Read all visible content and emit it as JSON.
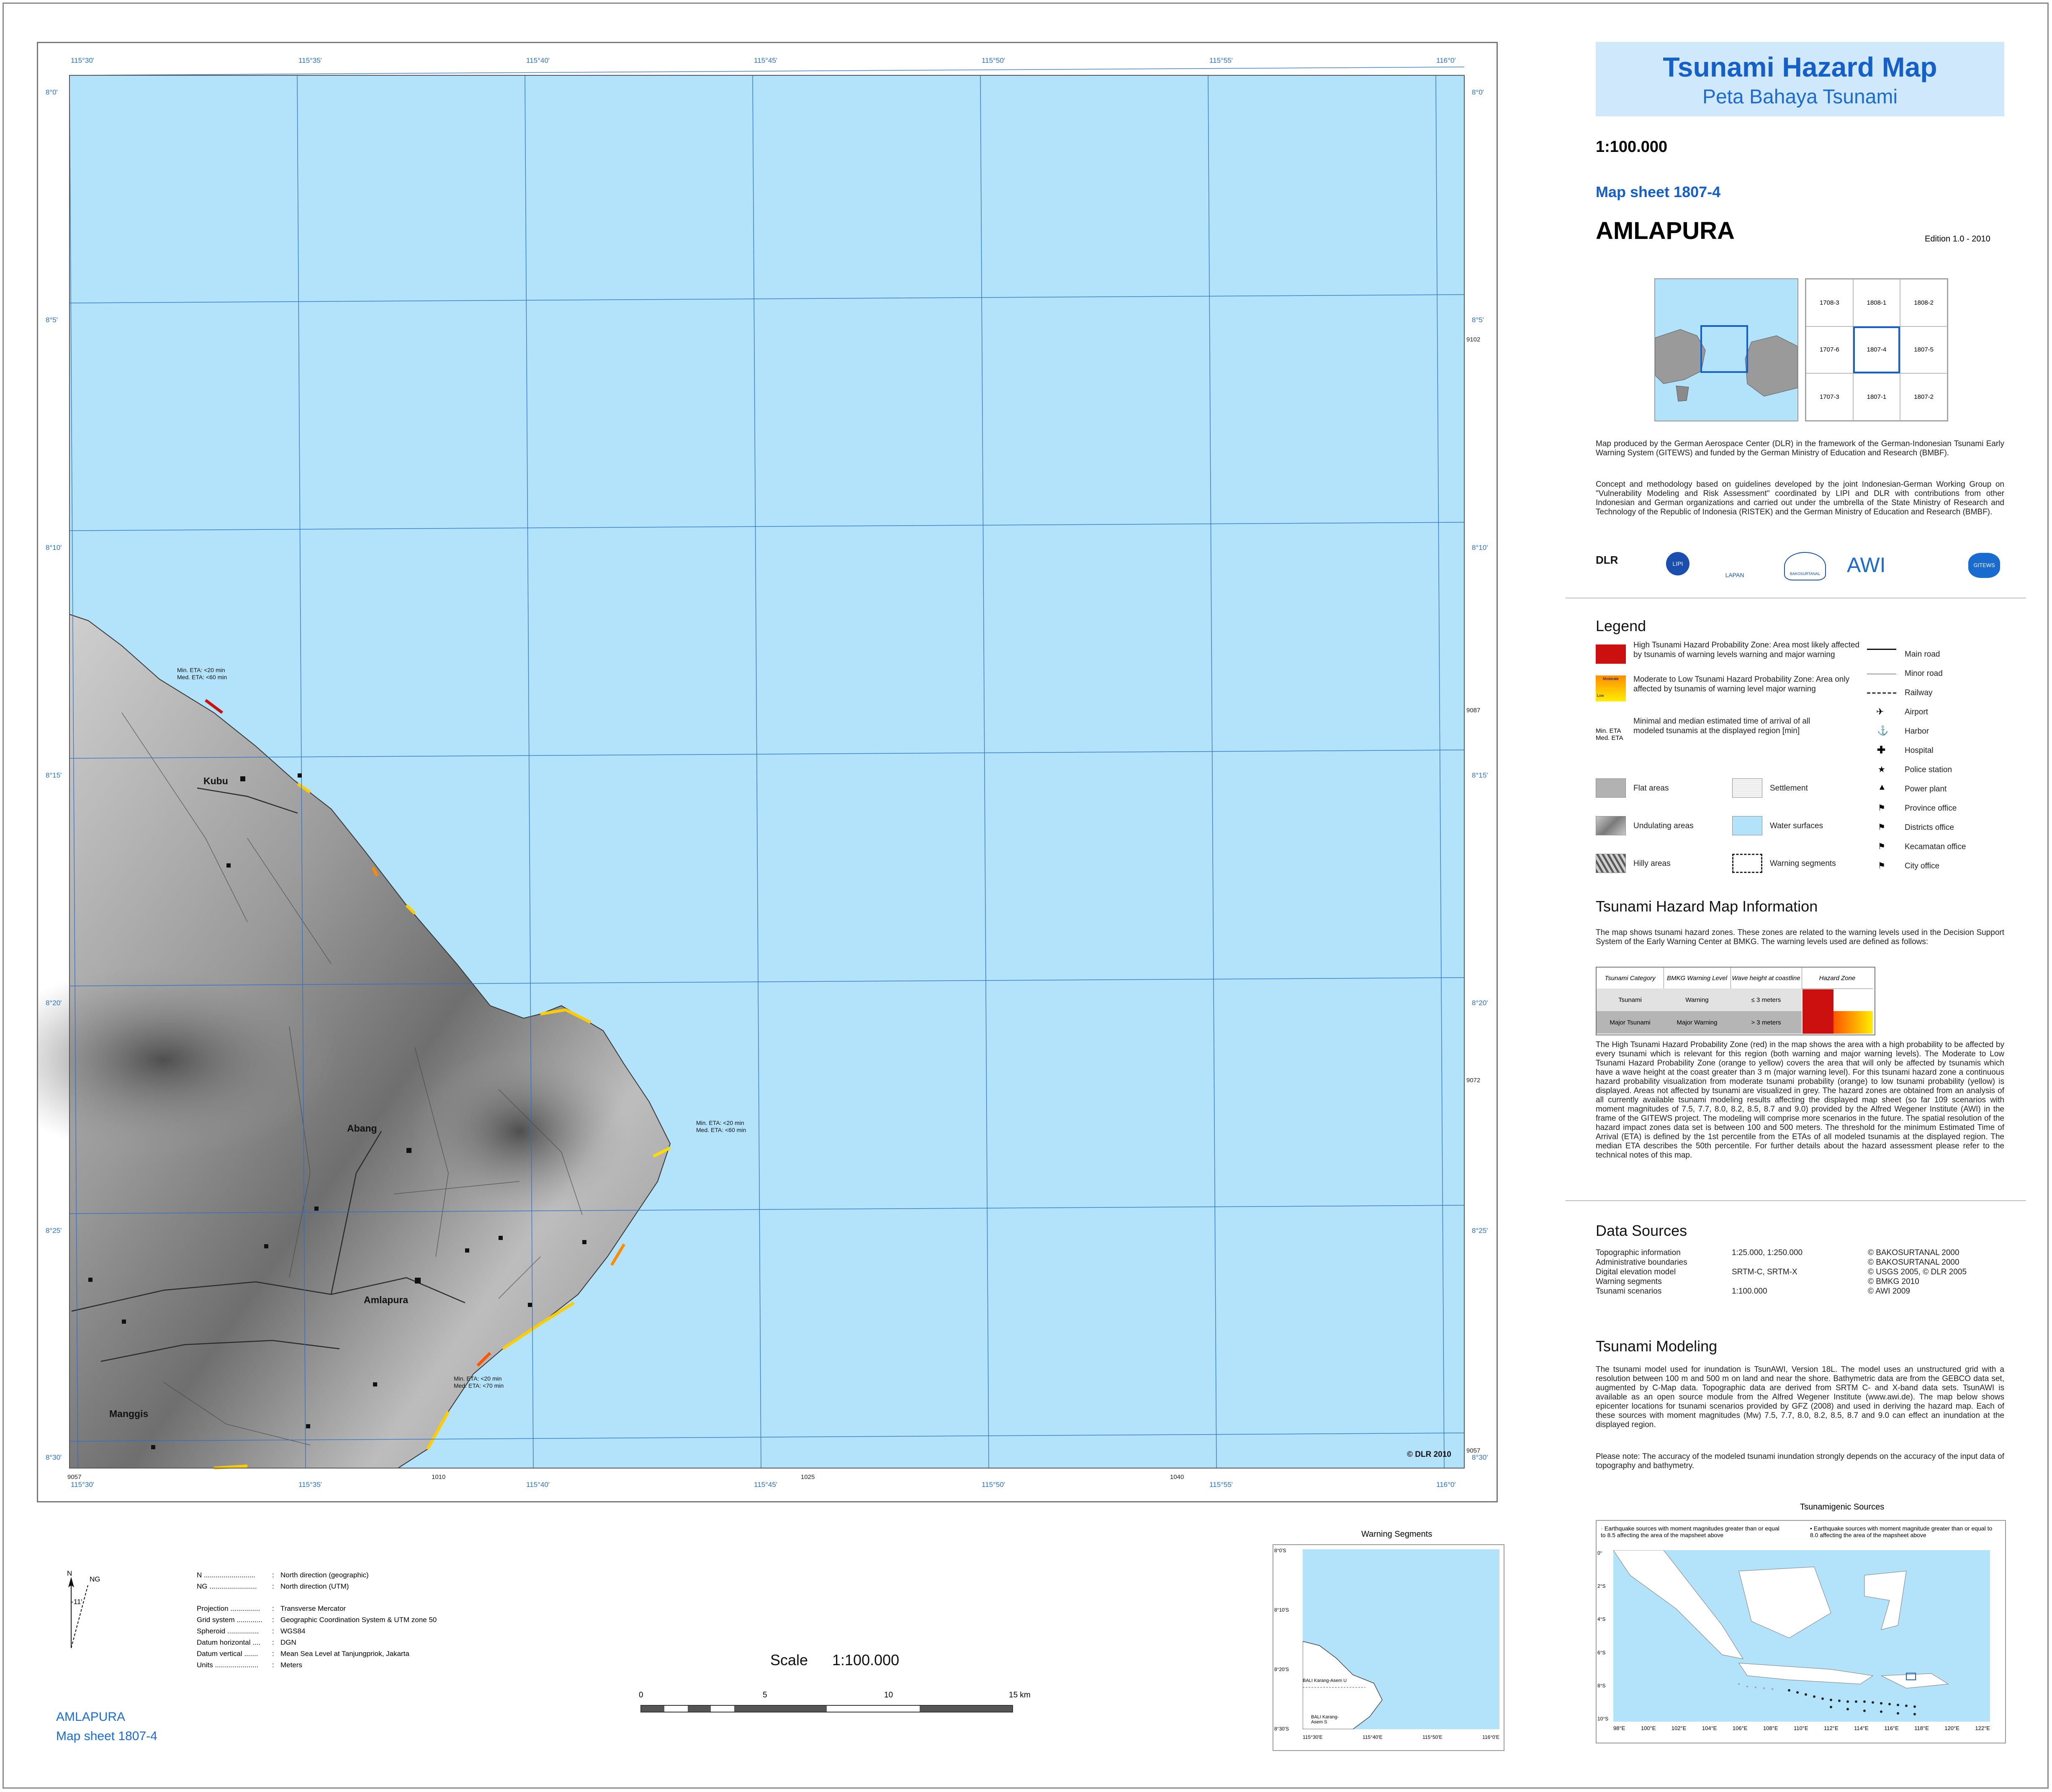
{
  "title": {
    "main": "Tsunami Hazard Map",
    "sub": "Peta Bahaya Tsunami"
  },
  "scale_label": "1:100.000",
  "map_sheet": "Map sheet  1807-4",
  "region": "AMLAPURA",
  "edition": "Edition 1.0   -   2010",
  "index_grid": [
    "1708-3",
    "1808-1",
    "1808-2",
    "1707-6",
    "1807-4",
    "1807-5",
    "1707-3",
    "1807-1",
    "1807-2"
  ],
  "about": [
    "Map produced by the German Aerospace Center (DLR) in the framework of the German-Indonesian Tsunami Early Warning System (GITEWS) and funded by the German Ministry of Education and Research (BMBF).",
    "Concept and methodology based on guidelines developed by the joint Indonesian-German Working Group on \"Vulnerability Modeling and Risk Assessment\" coordinated by LIPI and DLR with contributions from other Indonesian and German organizations and carried out under the umbrella of the State Ministry of Research and Technology of the Republic of Indonesia (RISTEK) and the German Ministry of Education and Research (BMBF)."
  ],
  "logos": [
    "DLR",
    "LIPI",
    "LAPAN",
    "BAKOSURTANAL",
    "AWI",
    "GITEWS"
  ],
  "legend": {
    "heading": "Legend",
    "zones": [
      {
        "text": "High Tsunami Hazard Probability Zone: Area most likely affected by tsunamis of warning levels warning and major warning",
        "color": "#cc1010"
      },
      {
        "text": "Moderate to Low Tsunami Hazard Probability Zone: Area only affected by tsunamis of warning level major warning",
        "label_top": "Moderate",
        "label_bottom": "Low"
      },
      {
        "text": "Minimal and median estimated time of arrival of all modeled tsunamis at the displayed region [min]",
        "label_top": "Min. ETA",
        "label_bottom": "Med. ETA"
      }
    ],
    "areas": [
      {
        "text": "Flat areas",
        "color": "#b2b2b2"
      },
      {
        "text": "Settlement",
        "color": "#eeeeee"
      },
      {
        "text": "Undulating areas",
        "color": "#9a9a9a"
      },
      {
        "text": "Water surfaces",
        "color": "#b3e3fa"
      },
      {
        "text": "Hilly areas",
        "color": "#8a8a8a"
      },
      {
        "text": "Warning segments",
        "color": "#ffffff"
      }
    ],
    "symbols": [
      "Main road",
      "Minor road",
      "Railway",
      "Airport",
      "Harbor",
      "Hospital",
      "Police station",
      "Power plant",
      "Province office",
      "Districts office",
      "Kecamatan office",
      "City office"
    ]
  },
  "info": {
    "heading": "Tsunami Hazard Map Information",
    "intro": "The map shows tsunami hazard zones. These zones are related to the warning levels used in the Decision Support System of the Early Warning Center at BMKG. The warning levels used are defined as follows:",
    "table_headers": [
      "Tsunami Category",
      "BMKG Warning Level",
      "Wave height at coastline",
      "Hazard Zone"
    ],
    "table_rows": [
      [
        "Tsunami",
        "Warning",
        "≤ 3 meters"
      ],
      [
        "Major Tsunami",
        "Major Warning",
        "> 3 meters"
      ]
    ],
    "body": "The High Tsunami Hazard Probability Zone (red) in the map shows the area with a high probability to be affected by every tsunami which is relevant for this region (both warning and major warning levels). The Moderate to Low Tsunami Hazard Probability Zone (orange to yellow) covers the area that will only be affected by tsunamis which have a wave height at the coast greater than 3 m (major warning level). For this tsunami hazard zone a continuous hazard probability visualization from moderate tsunami probability (orange) to low tsunami probability (yellow) is displayed. Areas not affected by tsunami are visualized in grey. The hazard zones are obtained from an analysis of all currently available tsunami modeling results affecting the displayed map sheet (so far 109 scenarios with moment magnitudes of 7.5, 7.7, 8.0, 8.2, 8.5, 8.7 and 9.0) provided by the Alfred Wegener Institute (AWI) in the frame of the GITEWS project. The modeling will comprise more scenarios in the future. The spatial resolution of the hazard impact zones data set is between 100 and 500 meters. The threshold for the minimum Estimated Time of Arrival (ETA) is defined by the 1st percentile from the ETAs of all modeled tsunamis at the displayed region. The median ETA describes the 50th percentile. For further details about the hazard assessment please refer to the technical notes of this map."
  },
  "data_sources": {
    "heading": "Data Sources",
    "rows": [
      [
        "Topographic information",
        "1:25.000, 1:250.000",
        "© BAKOSURTANAL 2000"
      ],
      [
        "Administrative boundaries",
        "",
        "© BAKOSURTANAL 2000"
      ],
      [
        "Digital elevation model",
        "SRTM-C, SRTM-X",
        "© USGS 2005, © DLR 2005"
      ],
      [
        "Warning segments",
        "",
        "© BMKG 2010"
      ],
      [
        "Tsunami scenarios",
        "1:100.000",
        "© AWI 2009"
      ]
    ]
  },
  "modeling": {
    "heading": "Tsunami Modeling",
    "body": "The tsunami model used for inundation is TsunAWI, Version 18L. The model uses an unstructured grid with a resolution between 100 m and 500 m on land and near the shore. Bathymetric data are from the GEBCO data set, augmented by C-Map data. Topographic data are derived from SRTM C- and X-band data sets. TsunAWI is available as an open source module from the Alfred Wegener Institute (www.awi.de). The map below shows epicenter locations for tsunami scenarios provided by GFZ (2008) and used in deriving the hazard map. Each of these sources with moment magnitudes (Mw) 7.5, 7.7, 8.0, 8.2, 8.5, 8.7 and 9.0 can effect an inundation at the displayed region.",
    "note": "Please note: The accuracy of the modeled tsunami inundation strongly depends on the accuracy of the input data of topography and bathymetry."
  },
  "sources_map": {
    "title": "Tsunamigenic Sources",
    "legend_a": "Earthquake sources with moment magnitudes greater than or equal to 8.5 affecting the area of the mapsheet above",
    "legend_b": "Earthquake sources with moment magnitude greater than or equal to 8.0 affecting the area of the mapsheet above",
    "lon_labels": [
      "98°E",
      "100°E",
      "102°E",
      "104°E",
      "106°E",
      "108°E",
      "110°E",
      "112°E",
      "114°E",
      "116°E",
      "118°E",
      "120°E",
      "122°E"
    ],
    "lat_labels": [
      "0°",
      "2°S",
      "4°S",
      "6°S",
      "8°S",
      "10°S"
    ]
  },
  "warning_map": {
    "title": "Warning Segments",
    "lat_labels": [
      "8°0'S",
      "8°10'S",
      "8°20'S",
      "8°30'S"
    ],
    "lon_labels": [
      "115°30'E",
      "115°40'E",
      "115°50'E",
      "116°0'E"
    ],
    "label_a": "BALI Karang-Asem U",
    "label_b": "BALI Karang-Asem S"
  },
  "map": {
    "lon_labels": [
      "115°30'",
      "115°35'",
      "115°40'",
      "115°45'",
      "115°50'",
      "115°55'",
      "116°0'"
    ],
    "lat_labels": [
      "8°0'",
      "8°5'",
      "8°10'",
      "8°15'",
      "8°20'",
      "8°25'",
      "8°30'"
    ],
    "utm_right": [
      "9102",
      "9087",
      "9072",
      "9057"
    ],
    "utm_bottom": [
      "9057",
      "1010",
      "1025",
      "1040"
    ],
    "places": [
      "Kubu",
      "Abang",
      "Amlapura",
      "Manggis"
    ],
    "eta_labels": [
      [
        "Min. ETA: <20 min",
        "Med. ETA: <60 min"
      ],
      [
        "Min. ETA: <20 min",
        "Med. ETA: <60 min"
      ],
      [
        "Min. ETA: <20 min",
        "Med. ETA: <70 min"
      ]
    ],
    "copyright": "© DLR 2010"
  },
  "projection": {
    "north_labels": [
      "N",
      "NG",
      "-11'"
    ],
    "rows": [
      [
        "N ..........................",
        ":",
        "North direction (geographic)"
      ],
      [
        "NG ........................",
        ":",
        "North direction (UTM)"
      ],
      [
        "Projection ...............",
        ":",
        "Transverse Mercator"
      ],
      [
        "Grid system .............",
        ":",
        "Geographic Coordination System & UTM zone  50"
      ],
      [
        "Spheroid ................",
        ":",
        "WGS84"
      ],
      [
        "Datum horizontal ....",
        ":",
        "DGN"
      ],
      [
        "Datum vertical .......",
        ":",
        "Mean Sea Level at Tanjungpriok, Jakarta"
      ],
      [
        "Units ......................",
        ":",
        "Meters"
      ]
    ]
  },
  "scale_bar": {
    "label": "Scale",
    "value": "1:100.000",
    "ticks": [
      "0",
      "5",
      "10",
      "15 km"
    ]
  },
  "footer": {
    "region": "AMLAPURA",
    "sheet": "Map sheet  1807-4"
  },
  "colors": {
    "water": "#b3e3fa",
    "land": "#aaaaaa",
    "accent": "#1560c8",
    "high_hazard": "#cc1010",
    "moderate": "#ff8c00",
    "low": "#ffee00"
  }
}
